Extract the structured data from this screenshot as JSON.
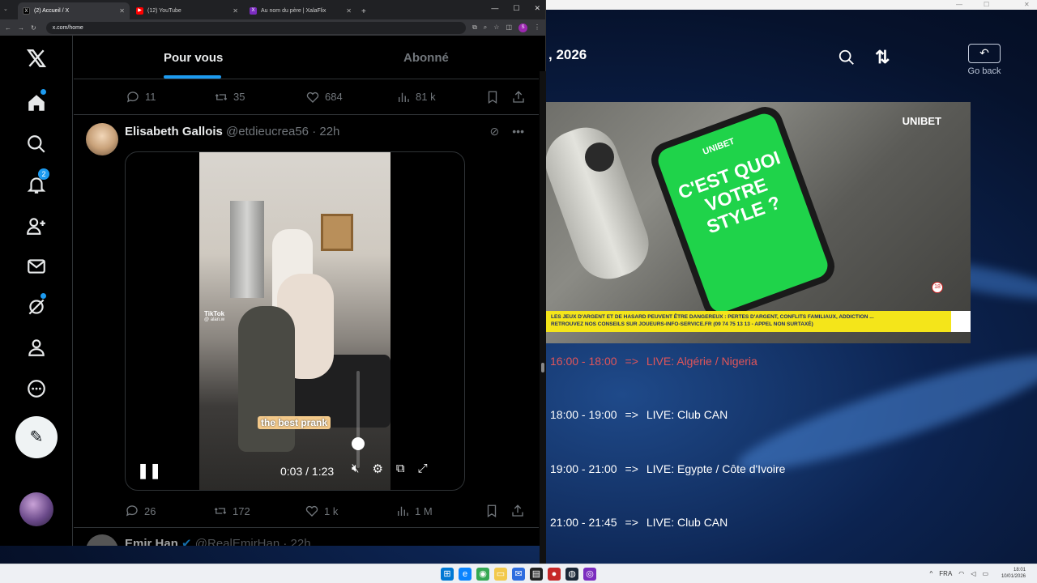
{
  "browser": {
    "tabs": [
      {
        "label": "(2) Accueil / X",
        "favicon": "X",
        "color": "#000000"
      },
      {
        "label": "(12) YouTube",
        "favicon": "▶",
        "color": "#ff0000"
      },
      {
        "label": "Au nom du père | XalaFlix",
        "favicon": "X",
        "color": "#7b2cbf"
      }
    ],
    "url": "x.com/home",
    "profile_initial": "S",
    "window_controls": {
      "minimize": "—",
      "maximize": "☐",
      "close": "✕"
    }
  },
  "x": {
    "nav_badges": {
      "notifications": "2"
    },
    "feed_tabs": {
      "for_you": "Pour vous",
      "following": "Abonné"
    },
    "prev_tweet_stats": {
      "replies": "11",
      "reposts": "35",
      "likes": "684",
      "views": "81 k"
    },
    "tweet": {
      "name": "Elisabeth Gallois",
      "handle": "@etdieucrea56",
      "time": "· 22h",
      "video": {
        "watermark": "TikTok",
        "watermark_user": "@ alan.w",
        "caption": "the best prank",
        "time": "0:03 / 1:23",
        "volume": 0.25
      },
      "stats": {
        "replies": "26",
        "reposts": "172",
        "likes": "1 k",
        "views": "1 M"
      }
    },
    "next_tweet": {
      "name": "Emir Han",
      "handle": "@RealEmirHan",
      "time": "· 22h"
    }
  },
  "stream": {
    "date": ", 2026",
    "go_back": "Go back",
    "ad": {
      "brand": "UNIBET",
      "phone_brand": "UNIBET",
      "slogan": "C'EST QUOI VOTRE STYLE ?",
      "rating": "18",
      "banner_line1": "LES JEUX D'ARGENT ET DE HASARD PEUVENT ÊTRE DANGEREUX : PERTES D'ARGENT, CONFLITS FAMILIAUX, ADDICTION ...",
      "banner_line2": "RETROUVEZ NOS CONSEILS SUR JOUEURS-INFO-SERVICE.FR (09 74 75 13 13 - APPEL NON SURTAXÉ)"
    },
    "schedule": [
      {
        "time": "16:00 - 18:00",
        "arrow": "=>",
        "title": "LIVE: Algérie / Nigeria",
        "live": true
      },
      {
        "time": "18:00 - 19:00",
        "arrow": "=>",
        "title": "LIVE: Club CAN",
        "live": false
      },
      {
        "time": "19:00 - 21:00",
        "arrow": "=>",
        "title": "LIVE: Egypte / Côte d'Ivoire",
        "live": false
      },
      {
        "time": "21:00 - 21:45",
        "arrow": "=>",
        "title": "LIVE: Club CAN",
        "live": false
      }
    ]
  },
  "taskbar": {
    "lang": "FRA",
    "time": "18:01",
    "date": "10/01/2026"
  }
}
